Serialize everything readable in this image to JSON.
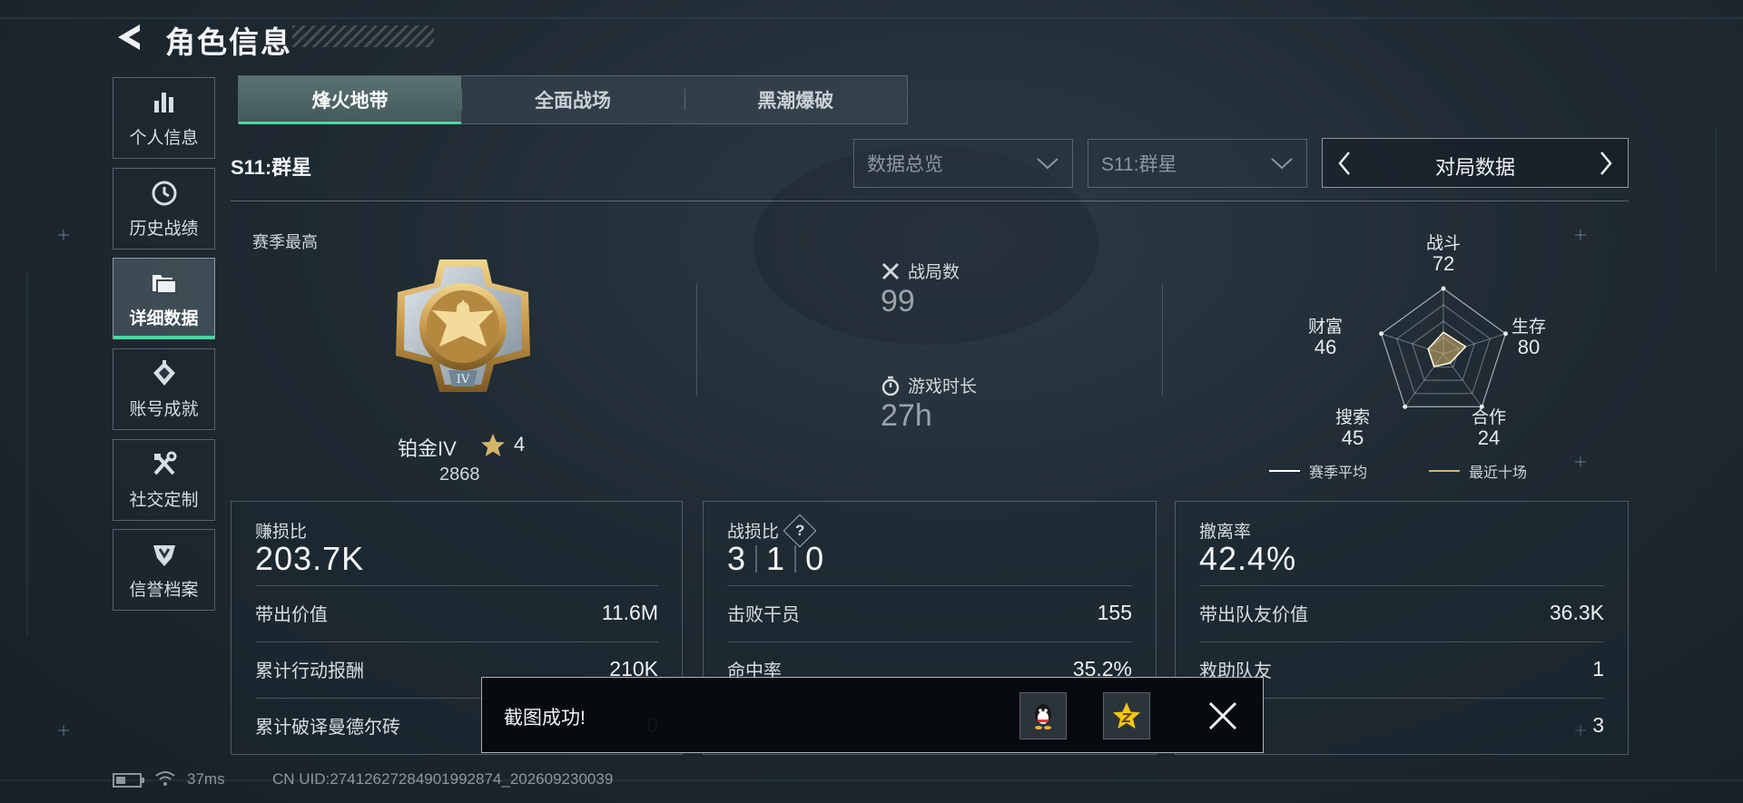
{
  "header": {
    "title": "角色信息",
    "back_icon": "back-arrow-icon"
  },
  "sidebar": {
    "items": [
      {
        "label": "个人信息",
        "icon": "bar-chart-icon",
        "active": false
      },
      {
        "label": "历史战绩",
        "icon": "clock-icon",
        "active": false
      },
      {
        "label": "详细数据",
        "icon": "folder-icon",
        "active": true
      },
      {
        "label": "账号成就",
        "icon": "achievement-icon",
        "active": false
      },
      {
        "label": "社交定制",
        "icon": "tools-icon",
        "active": false
      },
      {
        "label": "信誉档案",
        "icon": "shield-icon",
        "active": false
      }
    ]
  },
  "mode_tabs": [
    {
      "label": "烽火地带",
      "active": true
    },
    {
      "label": "全面战场",
      "active": false
    },
    {
      "label": "黑潮爆破",
      "active": false
    }
  ],
  "season": {
    "label": "S11:群星",
    "dropdown_view": "数据总览",
    "dropdown_season": "S11:群星",
    "pager_label": "对局数据"
  },
  "rank": {
    "section_label": "赛季最高",
    "badge_numeral": "IV",
    "name": "铂金IV",
    "stars": "4",
    "score": "2868"
  },
  "match_stats": {
    "games_label": "战局数",
    "games_value": "99",
    "time_label": "游戏时长",
    "time_value": "27h"
  },
  "radar": {
    "axes": [
      {
        "label": "战斗",
        "value": "72"
      },
      {
        "label": "生存",
        "value": "80"
      },
      {
        "label": "合作",
        "value": "24"
      },
      {
        "label": "搜索",
        "value": "45"
      },
      {
        "label": "财富",
        "value": "46"
      }
    ],
    "scale_max": 100,
    "legend": [
      {
        "label": "赛季平均",
        "color": "#ffffff"
      },
      {
        "label": "最近十场",
        "color": "#d6b56a"
      }
    ]
  },
  "cards": {
    "profit": {
      "title": "赚损比",
      "big": "203.7K",
      "rows": [
        {
          "label": "带出价值",
          "value": "11.6M"
        },
        {
          "label": "累计行动报酬",
          "value": "210K"
        },
        {
          "label": "累计破译曼德尔砖",
          "value": "0"
        }
      ]
    },
    "kd": {
      "title": "战损比",
      "help": "?",
      "kda": [
        "3",
        "1",
        "0"
      ],
      "rows": [
        {
          "label": "击败干员",
          "value": "155"
        },
        {
          "label": "命中率",
          "value": "35.2%"
        }
      ]
    },
    "extract": {
      "title": "撤离率",
      "big": "42.4%",
      "rows": [
        {
          "label": "带出队友价值",
          "value": "36.3K"
        },
        {
          "label": "救助队友",
          "value": "1"
        },
        {
          "label": "",
          "value": "3"
        }
      ]
    }
  },
  "toast": {
    "message": "截图成功!"
  },
  "status": {
    "ping": "37ms",
    "uid": "CN UID:2741262728490199287​4_202609230039"
  },
  "colors": {
    "accent": "#49d9a2",
    "gold": "#d6b56a"
  }
}
